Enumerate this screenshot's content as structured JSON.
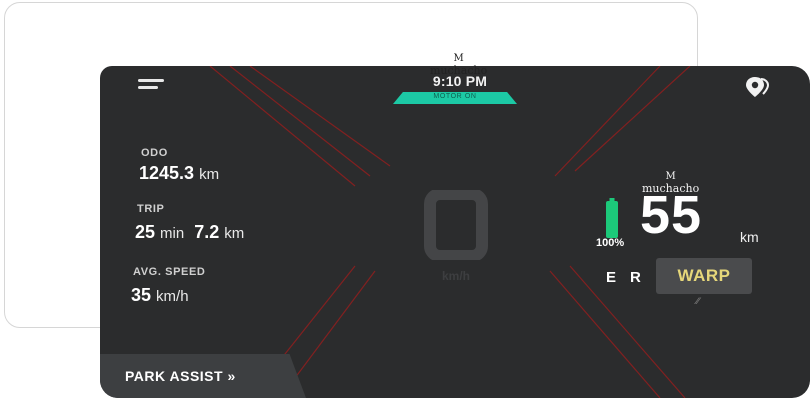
{
  "header": {
    "time": "9:10 PM",
    "motor_status": "MOTOR ON"
  },
  "stats": {
    "odo": {
      "label": "ODO",
      "value": "1245.3",
      "unit": "km"
    },
    "trip": {
      "label": "TRIP",
      "duration_value": "25",
      "duration_unit": "min",
      "distance_value": "7.2",
      "distance_unit": "km"
    },
    "avg_speed": {
      "label": "AVG. SPEED",
      "value": "35",
      "unit": "km/h"
    }
  },
  "speedometer": {
    "digit": "0",
    "unit": "km/h"
  },
  "battery": {
    "percent": "100%",
    "level": 1.0,
    "color": "#1cc97a"
  },
  "range": {
    "value": "55",
    "unit": "km"
  },
  "modes": {
    "e": "E",
    "r": "R",
    "active": "WARP"
  },
  "park_assist": {
    "label": "PARK ASSIST »"
  },
  "watermark": {
    "text": "muchacho",
    "letter": "M"
  },
  "colors": {
    "accent": "#1cc9a5",
    "warp_text": "#e6d77a",
    "screen_bg": "#2b2c2d",
    "streak": "#8c1f1f"
  },
  "icons": {
    "menu": "hamburger-menu-icon",
    "location": "location-pin-icon",
    "battery": "battery-icon"
  }
}
